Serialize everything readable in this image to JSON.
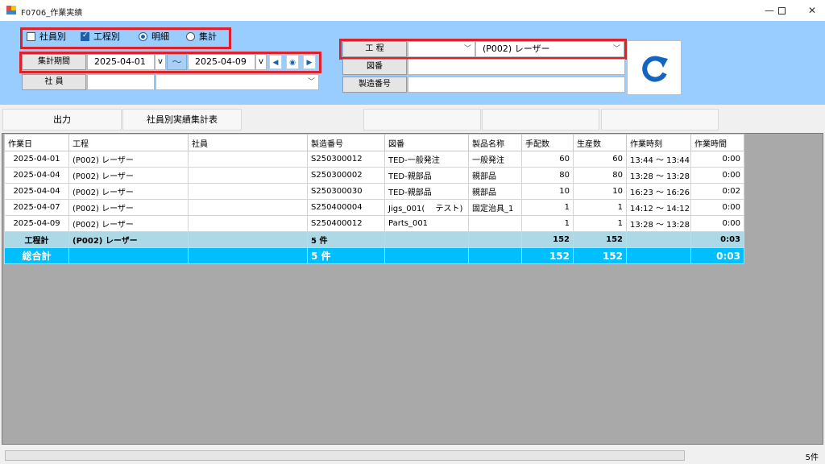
{
  "window": {
    "title": "F0706_作業実績",
    "min": "—",
    "max": "☐",
    "close": "✕"
  },
  "filters": {
    "by_employee": {
      "label": "社員別",
      "checked": false
    },
    "by_process": {
      "label": "工程別",
      "checked": true
    },
    "detail": {
      "label": "明細",
      "selected": true
    },
    "summary": {
      "label": "集計",
      "selected": false
    },
    "period_label": "集計期間",
    "date_from": "2025-04-01",
    "date_to": "2025-04-09",
    "dropdown_v": "v",
    "tilde": "～",
    "employee_label": "社 員",
    "employee_code": "",
    "employee_name": "",
    "process_label": "工 程",
    "process_code": "",
    "process_value": "(P002) レーザー",
    "drawing_label": "図番",
    "drawing_value": "",
    "serial_label": "製造番号",
    "serial_value": ""
  },
  "toolbar": {
    "output_label": "出力",
    "report_label": "社員別実績集計表"
  },
  "table": {
    "columns": [
      "作業日",
      "工程",
      "社員",
      "製造番号",
      "図番",
      "製品名称",
      "手配数",
      "生産数",
      "作業時刻",
      "作業時間"
    ],
    "rows": [
      {
        "date": "2025-04-01",
        "process": "(P002) レーザー",
        "employee": "",
        "serial": "S250300012",
        "drawing": "TED-一般発注",
        "product": "一般発注",
        "ordered": "60",
        "produced": "60",
        "time": "13:44 ～ 13:44",
        "duration": "0:00"
      },
      {
        "date": "2025-04-04",
        "process": "(P002) レーザー",
        "employee": "",
        "serial": "S250300002",
        "drawing": "TED-親部品",
        "product": "親部品",
        "ordered": "80",
        "produced": "80",
        "time": "13:28 ～ 13:28",
        "duration": "0:00"
      },
      {
        "date": "2025-04-04",
        "process": "(P002) レーザー",
        "employee": "",
        "serial": "S250300030",
        "drawing": "TED-親部品",
        "product": "親部品",
        "ordered": "10",
        "produced": "10",
        "time": "16:23 ～ 16:26",
        "duration": "0:02"
      },
      {
        "date": "2025-04-07",
        "process": "(P002) レーザー",
        "employee": "",
        "serial": "S250400004",
        "drawing": "Jigs_001(　 テスト)",
        "product": "固定治具_1",
        "ordered": "1",
        "produced": "1",
        "time": "14:12 ～ 14:12",
        "duration": "0:00"
      },
      {
        "date": "2025-04-09",
        "process": "(P002) レーザー",
        "employee": "",
        "serial": "S250400012",
        "drawing": "Parts_001",
        "product": "",
        "ordered": "1",
        "produced": "1",
        "time": "13:28 ～ 13:28",
        "duration": "0:00"
      }
    ],
    "subtotal": {
      "label": "工程計",
      "process": "(P002) レーザー",
      "count": "5 件",
      "ordered": "152",
      "produced": "152",
      "duration": "0:03"
    },
    "total": {
      "label": "総合計",
      "count": "5 件",
      "ordered": "152",
      "produced": "152",
      "duration": "0:03"
    }
  },
  "status": {
    "count": "5件"
  },
  "colors": {
    "panel": "#99ccff",
    "highlight": "#e0202a",
    "total_row": "#00bfff",
    "subtotal_row": "#add8e6"
  }
}
